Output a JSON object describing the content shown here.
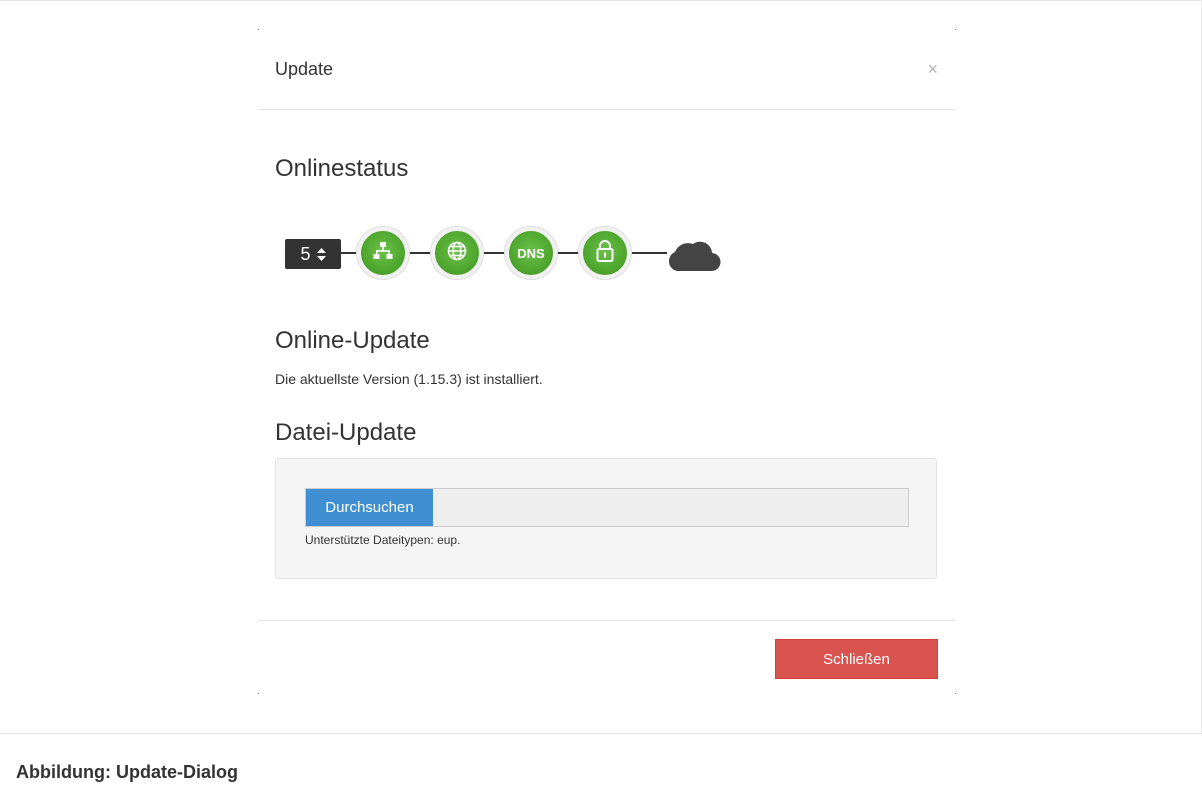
{
  "modal": {
    "title": "Update",
    "close_symbol": "×"
  },
  "onlinestatus": {
    "heading": "Onlinestatus",
    "counter_value": "5",
    "counter_arrows": "up-down-arrows-icon",
    "nodes": [
      {
        "icon": "network-icon"
      },
      {
        "icon": "globe-icon"
      },
      {
        "icon": "dns-icon",
        "label": "DNS"
      },
      {
        "icon": "lock-icon"
      }
    ],
    "end_icon": "cloud-icon",
    "colors": {
      "node": "#4fa72e",
      "line": "#333333",
      "cloud": "#444444"
    }
  },
  "online_update": {
    "heading": "Online-Update",
    "text": "Die aktuellste Version (1.15.3) ist installiert."
  },
  "file_update": {
    "heading": "Datei-Update",
    "browse_label": "Durchsuchen",
    "file_value": "",
    "help_text": "Unterstützte Dateitypen: eup."
  },
  "footer": {
    "close_label": "Schließen"
  },
  "caption": "Abbildung: Update-Dialog",
  "colors": {
    "browse_button": "#3f8fd2",
    "close_button": "#d9534f"
  }
}
